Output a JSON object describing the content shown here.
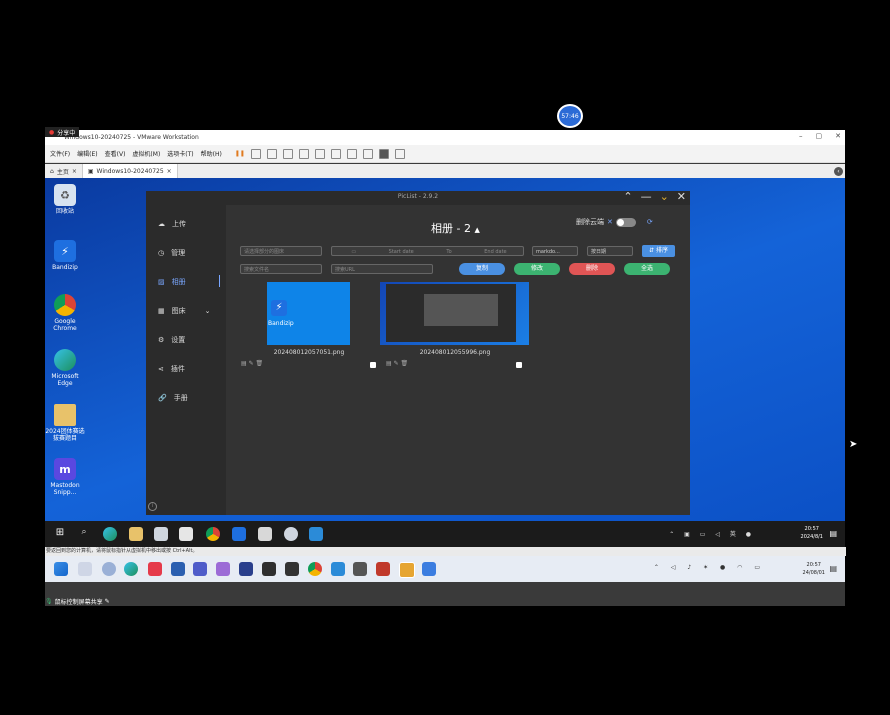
{
  "recording": {
    "time": "57:46"
  },
  "share": {
    "label": "分享中"
  },
  "vmware": {
    "title": "Windows10-20240725 - VMware Workstation",
    "menus": [
      "文件(F)",
      "编辑(E)",
      "查看(V)",
      "虚拟机(M)",
      "选项卡(T)",
      "帮助(H)"
    ],
    "tabs": [
      {
        "label": "主页"
      },
      {
        "label": "Windows10-20240725"
      }
    ],
    "status_text": "要返回到您的计算机，请将鼠标指针从虚拟机中移出或按 Ctrl+Alt。"
  },
  "desktop": {
    "icons": [
      {
        "label": "回收站",
        "name": "recycle-bin"
      },
      {
        "label": "Bandizip",
        "name": "bandizip"
      },
      {
        "label": "Google Chrome",
        "name": "google-chrome"
      },
      {
        "label": "Microsoft Edge",
        "name": "microsoft-edge"
      },
      {
        "label": "2024团体赛选拔赛题目",
        "name": "folder"
      },
      {
        "label": "Mastodon Snipp...",
        "name": "mastodon"
      }
    ]
  },
  "picgo": {
    "title": "PicList - 2.9.2",
    "heading": "相册 - 2",
    "delete_cloud_label": "删除云端",
    "nav": [
      {
        "label": "上传",
        "icon": "upload-icon"
      },
      {
        "label": "管理",
        "icon": "manage-icon"
      },
      {
        "label": "相册",
        "icon": "gallery-icon"
      },
      {
        "label": "图床",
        "icon": "grid-icon"
      },
      {
        "label": "设置",
        "icon": "gear-icon"
      },
      {
        "label": "插件",
        "icon": "share-icon"
      },
      {
        "label": "手册",
        "icon": "link-icon"
      }
    ],
    "filters": {
      "bed_placeholder": "请选择部分的图床",
      "start_date": "Start date",
      "to": "To",
      "end_date": "End date",
      "format": "markdo...",
      "sort": "按日期",
      "sort_button": "排序",
      "search_filename": "搜索文件名",
      "search_url": "搜索URL"
    },
    "buttons": {
      "copy": "复制",
      "edit": "修改",
      "delete": "删除",
      "select_all": "全选"
    },
    "images": [
      {
        "filename": "202408012057051.png"
      },
      {
        "filename": "202408012055996.png"
      }
    ]
  },
  "guest_clock": {
    "time": "20:57",
    "date": "2024/8/1"
  },
  "host_clock": {
    "time": "20:57",
    "date": "24/08/01"
  },
  "micbar": {
    "label": "鼠标控制屏幕共享"
  },
  "colors": {
    "blue": "#4a90e2",
    "green": "#3cb371",
    "red": "#e05555",
    "accent": "#1463d8"
  }
}
